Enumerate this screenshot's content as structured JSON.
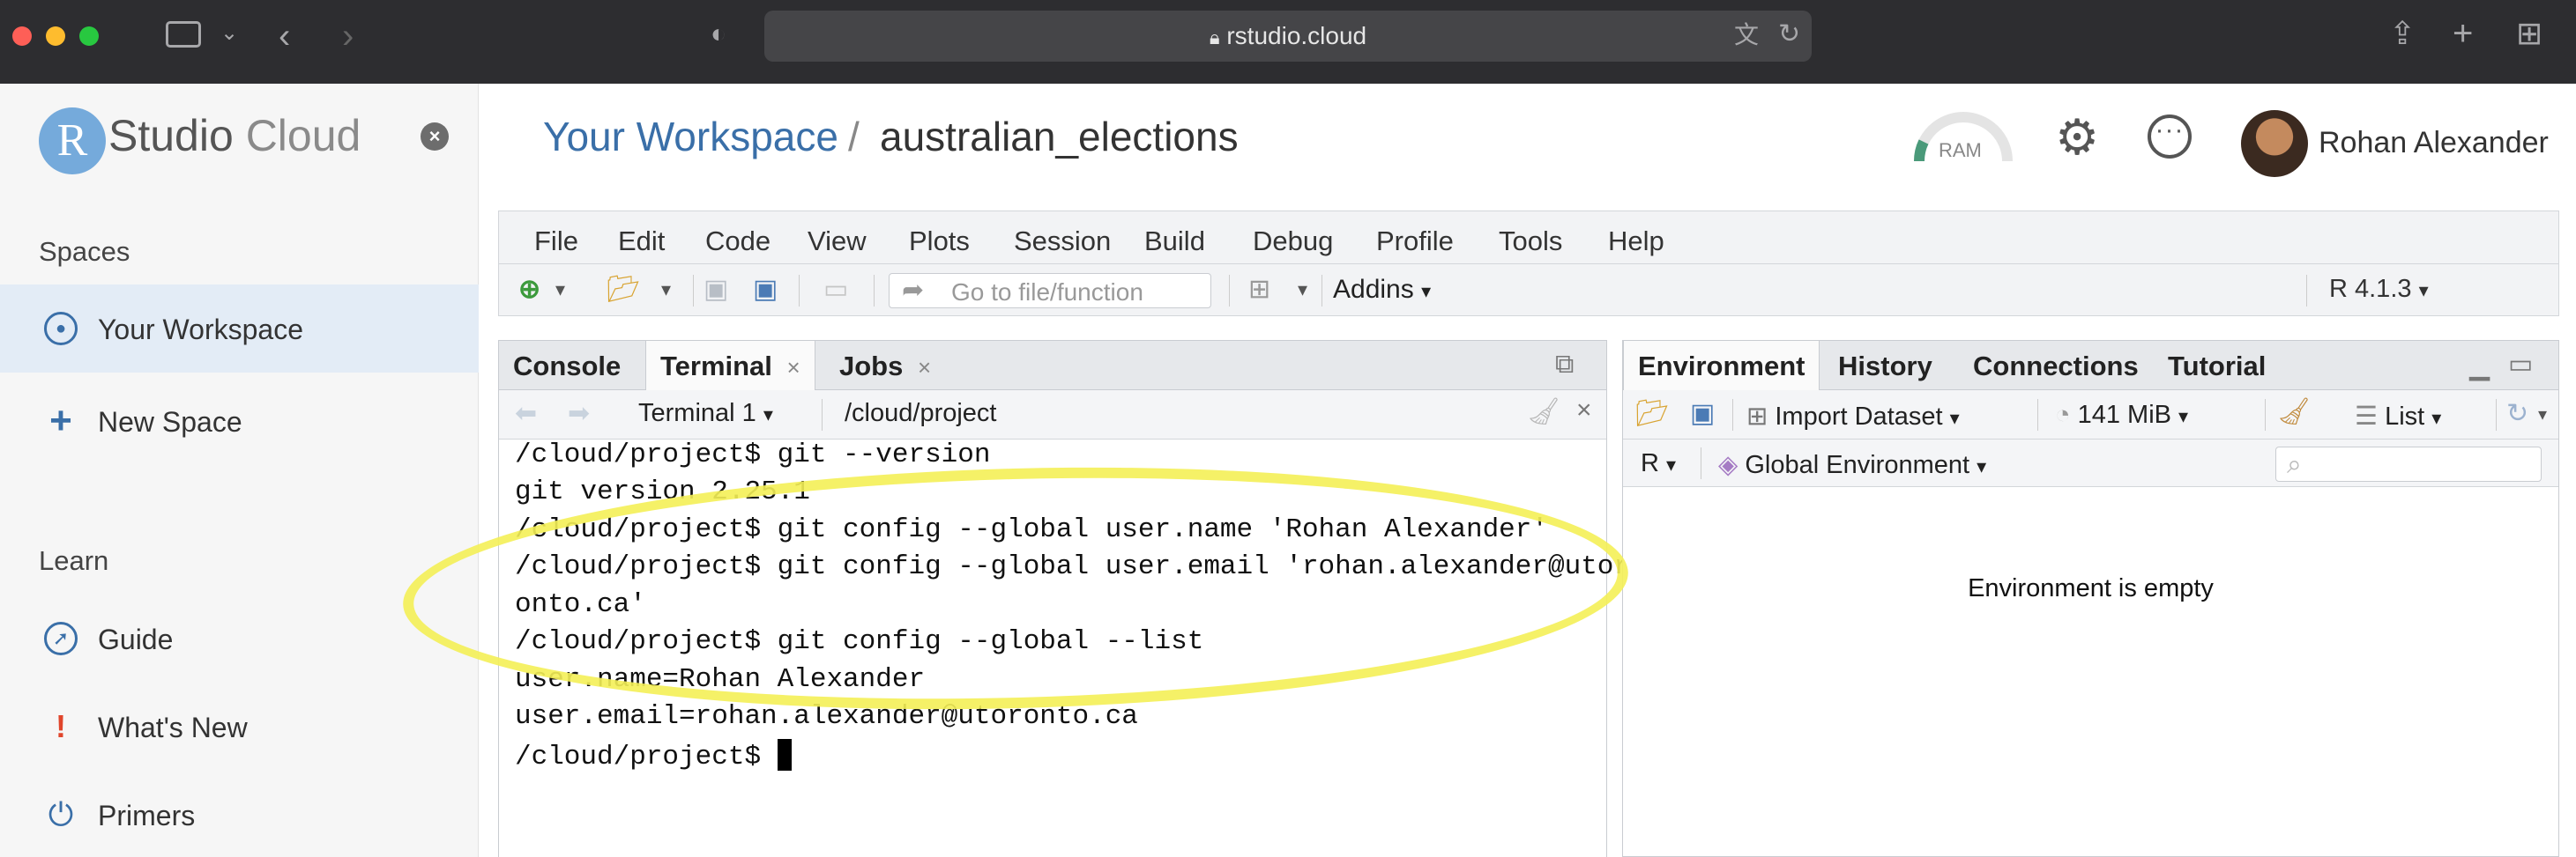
{
  "browser": {
    "url": "rstudio.cloud",
    "traffic_colors": [
      "#fe5f57",
      "#febc2e",
      "#28c840"
    ]
  },
  "sidebar": {
    "logo_letter": "R",
    "logo_studio": "Studio",
    "logo_cloud": "Cloud",
    "close_glyph": "×",
    "spaces_heading": "Spaces",
    "your_workspace": "Your Workspace",
    "new_space": "New Space",
    "learn_heading": "Learn",
    "guide": "Guide",
    "whats_new": "What's New",
    "primers": "Primers"
  },
  "header": {
    "workspace": "Your Workspace",
    "separator": "/",
    "project": "australian_elections",
    "ram_label": "RAM",
    "user_name": "Rohan Alexander"
  },
  "ide": {
    "menus": [
      "File",
      "Edit",
      "Code",
      "View",
      "Plots",
      "Session",
      "Build",
      "Debug",
      "Profile",
      "Tools",
      "Help"
    ],
    "goto_placeholder": "Go to file/function",
    "addins_label": "Addins",
    "r_version": "R 4.1.3",
    "left_tabs": {
      "console": "Console",
      "terminal": "Terminal",
      "jobs": "Jobs",
      "close_glyph": "×"
    },
    "terminal_selector": "Terminal 1",
    "terminal_path": "/cloud/project",
    "terminal_lines": [
      "/cloud/project$ git --version",
      "git version 2.25.1",
      "/cloud/project$ git config --global user.name 'Rohan Alexander'",
      "/cloud/project$ git config --global user.email 'rohan.alexander@utor",
      "onto.ca'",
      "/cloud/project$ git config --global --list",
      "user.name=Rohan Alexander",
      "user.email=rohan.alexander@utoronto.ca",
      "/cloud/project$ "
    ],
    "right_tabs": {
      "environment": "Environment",
      "history": "History",
      "connections": "Connections",
      "tutorial": "Tutorial"
    },
    "import_dataset": "Import Dataset",
    "memory": "141 MiB",
    "list_view": "List",
    "r_selector": "R",
    "global_env": "Global Environment",
    "env_empty": "Environment is empty"
  },
  "colors": {
    "accent_blue": "#3a6fa8",
    "highlight_yellow": "#f4ef57"
  }
}
